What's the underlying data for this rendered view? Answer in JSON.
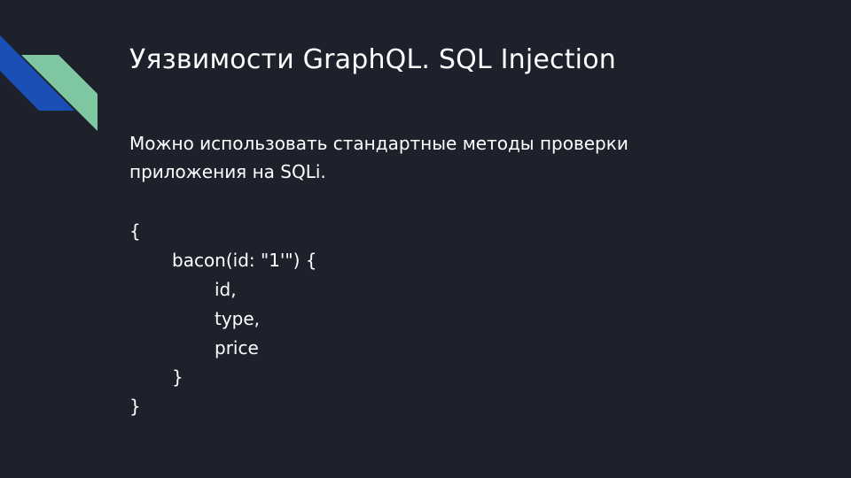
{
  "slide": {
    "title": "Уязвимости GraphQL. SQL Injection",
    "body_line1": "Можно использовать стандартные методы проверки",
    "body_line2": "приложения на SQLi.",
    "code_lines": [
      "{",
      "bacon(id: \"1'\") {",
      "id,",
      "type,",
      "price",
      "}",
      "}"
    ]
  },
  "colors": {
    "background": "#1d212b",
    "accent_blue": "#1a4fb5",
    "accent_green": "#7ec7a1",
    "text": "#ffffff"
  }
}
